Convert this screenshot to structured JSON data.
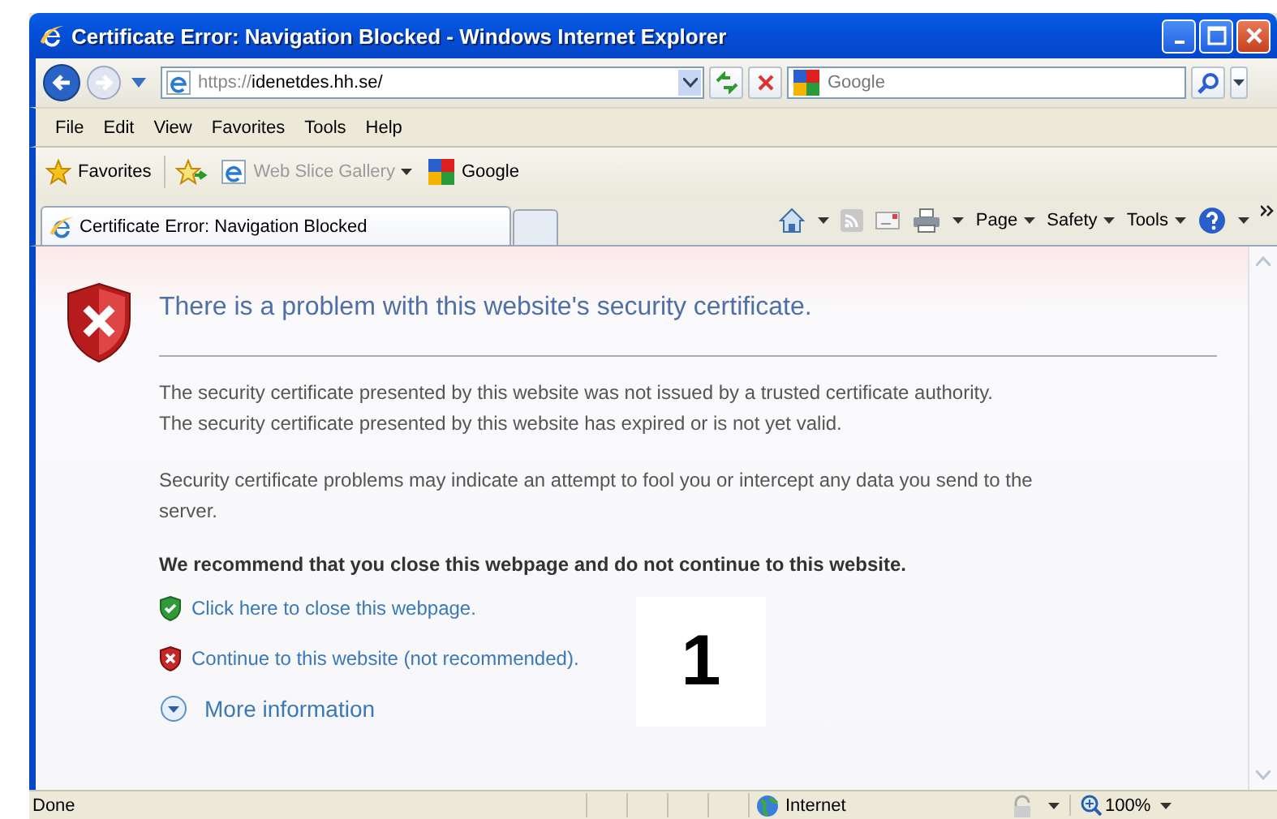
{
  "window": {
    "title": "Certificate Error: Navigation Blocked - Windows Internet Explorer"
  },
  "address_bar": {
    "url_prefix": "https://",
    "url_host": "idenetdes.hh.se/",
    "search_placeholder": "Google"
  },
  "menu": [
    "File",
    "Edit",
    "View",
    "Favorites",
    "Tools",
    "Help"
  ],
  "favorites_bar": {
    "favorites": "Favorites",
    "items": [
      {
        "label": "Web Slice Gallery",
        "kind": "dropdown",
        "disabled": true
      },
      {
        "label": "Google",
        "kind": "link",
        "disabled": false
      }
    ]
  },
  "tabs": [
    {
      "label": "Certificate Error: Navigation Blocked",
      "selected": true
    }
  ],
  "command_bar": [
    "Page",
    "Safety",
    "Tools"
  ],
  "content": {
    "heading": "There is a problem with this website's security certificate.",
    "paragraphs": [
      "The security certificate presented by this website was not issued by a trusted certificate authority.\nThe security certificate presented by this website has expired or is not yet valid.",
      "Security certificate problems may indicate an attempt to fool you or intercept any data you send to the server."
    ],
    "recommendation": "We recommend that you close this webpage and do not continue to this website.",
    "links": [
      {
        "label": "Click here to close this webpage.",
        "kind": "safe"
      },
      {
        "label": "Continue to this website (not recommended).",
        "kind": "unsafe"
      }
    ],
    "more_info": "More information"
  },
  "annotation": "1",
  "status_bar": {
    "status": "Done",
    "zone": "Internet",
    "zoom": "100%"
  }
}
